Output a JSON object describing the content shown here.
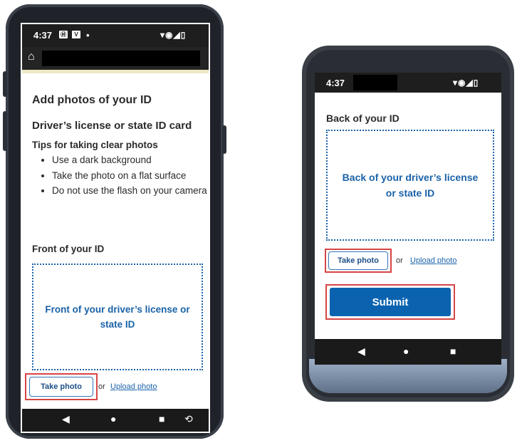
{
  "left_phone": {
    "status": {
      "time": "4:37",
      "app_icon_1": "Ⓜ",
      "app_icon_2": "V",
      "dot": "•",
      "right_icons": "▾◉◢▯"
    },
    "address_bar": {
      "home_icon": "⌂"
    },
    "title": "Add photos of your ID",
    "subtitle": "Driver’s license or state ID card",
    "tips_heading": "Tips for taking clear photos",
    "tips": [
      "Use a dark background",
      "Take the photo on a flat surface",
      "Do not use the flash on your camera"
    ],
    "front_heading": "Front of your ID",
    "front_dropzone": "Front of your driver’s license or state ID",
    "take_photo": "Take photo",
    "or": "or",
    "upload_photo": "Upload photo",
    "nav": {
      "back": "◀",
      "home": "●",
      "recents": "■",
      "rotate": "⟲"
    }
  },
  "right_phone": {
    "status": {
      "time": "4:37",
      "right_icons": "▾◉◢▯"
    },
    "back_heading": "Back of your ID",
    "back_dropzone": "Back of your driver’s license or state ID",
    "take_photo": "Take photo",
    "or": "or",
    "upload_photo": "Upload photo",
    "submit": "Submit",
    "nav": {
      "back": "◀",
      "home": "●",
      "recents": "■"
    }
  },
  "colors": {
    "link_blue": "#1a62a8",
    "submit_blue": "#0b63b0",
    "highlight_red": "#d64545"
  }
}
